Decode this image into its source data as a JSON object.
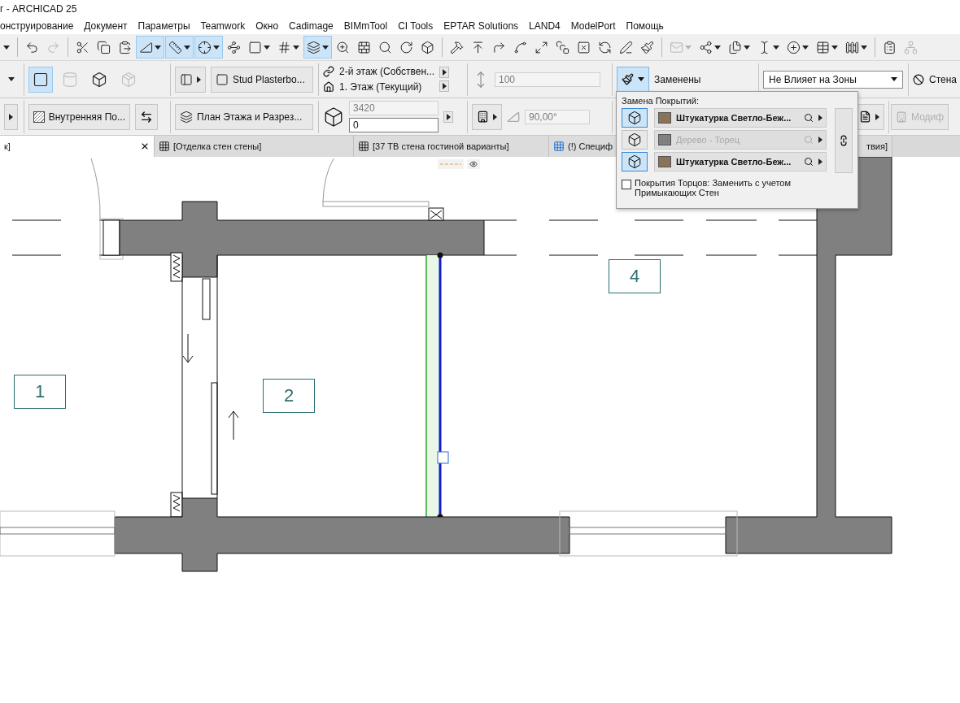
{
  "window": {
    "title": "г - ARCHICAD 25"
  },
  "menu_bar": [
    "онструирование",
    "Документ",
    "Параметры",
    "Teamwork",
    "Окно",
    "Cadimage",
    "BIMmTool",
    "CI Tools",
    "EPTAR Solutions",
    "LAND4",
    "ModelPort",
    "Помощь"
  ],
  "toolbar": [
    [
      {
        "kind": "blank",
        "selected": false,
        "disabled": false,
        "menu": true
      }
    ],
    [
      {
        "kind": "undo",
        "selected": false,
        "disabled": false,
        "menu": false
      },
      {
        "kind": "redo",
        "selected": false,
        "disabled": true,
        "menu": false
      }
    ],
    [
      {
        "kind": "cut",
        "selected": false,
        "disabled": false,
        "menu": false
      },
      {
        "kind": "copy",
        "selected": false,
        "disabled": false,
        "menu": false
      },
      {
        "kind": "paste",
        "selected": false,
        "disabled": false,
        "menu": false
      },
      {
        "kind": "triangle",
        "selected": true,
        "disabled": false,
        "menu": true
      },
      {
        "kind": "snap",
        "selected": true,
        "disabled": false,
        "menu": true
      },
      {
        "kind": "coordinates",
        "selected": true,
        "disabled": false,
        "menu": true
      },
      {
        "kind": "path",
        "selected": false,
        "disabled": false,
        "menu": false
      },
      {
        "kind": "frame",
        "selected": false,
        "disabled": false,
        "menu": true
      },
      {
        "kind": "grid",
        "selected": false,
        "disabled": false,
        "menu": true
      },
      {
        "kind": "plane",
        "selected": true,
        "disabled": false,
        "menu": true
      },
      {
        "kind": "zoom",
        "selected": false,
        "disabled": false,
        "menu": false
      },
      {
        "kind": "hatch",
        "selected": false,
        "disabled": false,
        "menu": false
      },
      {
        "kind": "find",
        "selected": false,
        "disabled": false,
        "menu": false
      },
      {
        "kind": "rotate",
        "selected": false,
        "disabled": false,
        "menu": false
      },
      {
        "kind": "view3d",
        "selected": false,
        "disabled": false,
        "menu": false
      }
    ],
    [
      {
        "kind": "hammer",
        "selected": false,
        "disabled": false,
        "menu": false
      },
      {
        "kind": "elevate",
        "selected": false,
        "disabled": false,
        "menu": false
      },
      {
        "kind": "corner",
        "selected": false,
        "disabled": false,
        "menu": false
      },
      {
        "kind": "arc",
        "selected": false,
        "disabled": false,
        "menu": false
      },
      {
        "kind": "resize",
        "selected": false,
        "disabled": false,
        "menu": false
      },
      {
        "kind": "stack",
        "selected": false,
        "disabled": false,
        "menu": false
      },
      {
        "kind": "crossbox",
        "selected": false,
        "disabled": false,
        "menu": false
      },
      {
        "kind": "refresh",
        "selected": false,
        "disabled": false,
        "menu": false
      },
      {
        "kind": "pen",
        "selected": false,
        "disabled": false,
        "menu": false
      },
      {
        "kind": "brush",
        "selected": false,
        "disabled": false,
        "menu": false
      }
    ],
    [
      {
        "kind": "mail",
        "selected": false,
        "disabled": true,
        "menu": true
      },
      {
        "kind": "nodes",
        "selected": false,
        "disabled": false,
        "menu": true
      },
      {
        "kind": "files",
        "selected": false,
        "disabled": false,
        "menu": true
      },
      {
        "kind": "beam",
        "selected": false,
        "disabled": false,
        "menu": true
      },
      {
        "kind": "addcircle",
        "selected": false,
        "disabled": false,
        "menu": true
      },
      {
        "kind": "table",
        "selected": false,
        "disabled": false,
        "menu": true
      },
      {
        "kind": "railing",
        "selected": false,
        "disabled": false,
        "menu": true
      }
    ],
    [
      {
        "kind": "report",
        "selected": false,
        "disabled": false,
        "menu": false
      },
      {
        "kind": "network",
        "selected": false,
        "disabled": true,
        "menu": false
      }
    ]
  ],
  "info_box": {
    "geometry_methods": [
      {
        "kind": "straight",
        "selected": true,
        "disabled": false
      },
      {
        "kind": "curved",
        "selected": false,
        "disabled": true
      },
      {
        "kind": "trapezoid",
        "selected": false,
        "disabled": false
      },
      {
        "kind": "polygon",
        "selected": false,
        "disabled": true
      }
    ],
    "structure": "Stud Plasterbo...",
    "top_link": "2-й этаж (Собствен...",
    "home_story": "1. Этаж (Текущий)",
    "offset": {
      "value": "100",
      "disabled": true
    },
    "surfaces": "Заменены",
    "zones": "Не Влияет на Зоны",
    "element": "Стена",
    "fill": "Внутренняя По...",
    "floor_plan_display": "План Этажа и Разрез...",
    "height": {
      "value": "3420",
      "disabled": true
    },
    "base_offset": {
      "value": "0",
      "disabled": false
    },
    "slant_angle": {
      "value": "90,00°",
      "disabled": true
    },
    "modify": {
      "label": "Модиф",
      "disabled": true
    }
  },
  "tabs": [
    {
      "label": "к]",
      "selected": true,
      "closable": true
    },
    {
      "label": "[Отделка стен стены]",
      "selected": false,
      "closable": false
    },
    {
      "label": "[37 ТВ стена гостиной варианты]",
      "selected": false,
      "closable": false
    },
    {
      "label": "(!) Специф",
      "label_end": "твия]",
      "selected": false,
      "closable": false
    }
  ],
  "rooms": [
    {
      "number": "1"
    },
    {
      "number": "2"
    },
    {
      "number": "4"
    }
  ],
  "surface_override": {
    "title": "Замена Покрытий:",
    "rows": [
      {
        "material": "Штукатурка Светло-Беж...",
        "color": "#8a7358",
        "selected": true,
        "disabled": false
      },
      {
        "material": "Дерево - Торец",
        "color": "#8c8c8c",
        "selected": false,
        "disabled": true
      },
      {
        "material": "Штукатурка Светло-Беж...",
        "color": "#8a7358",
        "selected": true,
        "disabled": false
      }
    ],
    "edge_option": {
      "label": "Покрытия Торцов: Заменить с учетом Примыкающих Стен",
      "checked": false
    }
  }
}
